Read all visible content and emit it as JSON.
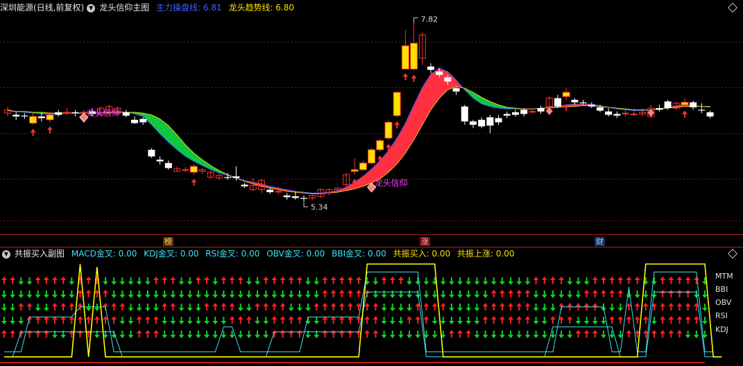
{
  "main_header": {
    "symbol": "深圳能源(日线,前复权)",
    "indicator_name": "龙头信仰主图",
    "line1_label": "主力操盘线: 6.81",
    "line2_label": "龙头趋势线: 6.80"
  },
  "sub_header": {
    "indicator_name": "共振买入副图",
    "items": [
      "MACD金叉: 0.00",
      "KDJ金叉: 0.00",
      "RSI金叉: 0.00",
      "OBV金叉: 0.00",
      "BBI金叉: 0.00",
      "共振买入: 0.00",
      "共振上涨: 0.00"
    ]
  },
  "markers": [
    "榜",
    "涨",
    "财"
  ],
  "signal_labels": [
    "MTM",
    "BBI",
    "OBV",
    "RSI",
    "KDJ"
  ],
  "colors": {
    "up_bar": "#ff3232",
    "down_bar": "#ffffff",
    "highlight_bar": "#ffe000",
    "band_up": "#ff3040",
    "band_down": "#10c840",
    "grid": "#8a1010",
    "sub_line_yellow": "#ffff00",
    "sub_line_cyan": "#40e0f0"
  },
  "chart_data": {
    "type": "candlestick",
    "annotations": [
      {
        "text": "7.82",
        "type": "max"
      },
      {
        "text": "5.34",
        "type": "min"
      },
      {
        "text": "龙头信仰",
        "type": "signal"
      },
      {
        "text": "龙头信仰",
        "type": "signal"
      }
    ],
    "candles": [
      {
        "o": 6.74,
        "c": 6.78,
        "h": 6.82,
        "l": 6.7
      },
      {
        "o": 6.72,
        "c": 6.7,
        "h": 6.76,
        "l": 6.66
      },
      {
        "o": 6.71,
        "c": 6.7,
        "h": 6.74,
        "l": 6.67
      },
      {
        "o": 6.62,
        "c": 6.7,
        "h": 6.74,
        "l": 6.6,
        "hl": 1
      },
      {
        "o": 6.7,
        "c": 6.68,
        "h": 6.74,
        "l": 6.64
      },
      {
        "o": 6.66,
        "c": 6.72,
        "h": 6.76,
        "l": 6.63,
        "hl": 1
      },
      {
        "o": 6.75,
        "c": 6.72,
        "h": 6.78,
        "l": 6.7
      },
      {
        "o": 6.74,
        "c": 6.75,
        "h": 6.8,
        "l": 6.71
      },
      {
        "o": 6.75,
        "c": 6.74,
        "h": 6.78,
        "l": 6.7
      },
      {
        "o": 6.74,
        "c": 6.75,
        "h": 6.78,
        "l": 6.72
      },
      {
        "o": 6.76,
        "c": 6.73,
        "h": 6.8,
        "l": 6.7
      },
      {
        "o": 6.72,
        "c": 6.8,
        "h": 6.82,
        "l": 6.7
      },
      {
        "o": 6.74,
        "c": 6.82,
        "h": 6.84,
        "l": 6.72
      },
      {
        "o": 6.74,
        "c": 6.8,
        "h": 6.82,
        "l": 6.72
      },
      {
        "o": 6.75,
        "c": 6.71,
        "h": 6.78,
        "l": 6.69
      },
      {
        "o": 6.66,
        "c": 6.62,
        "h": 6.7,
        "l": 6.61
      },
      {
        "o": 6.67,
        "c": 6.63,
        "h": 6.69,
        "l": 6.6
      },
      {
        "o": 6.3,
        "c": 6.22,
        "h": 6.32,
        "l": 6.2
      },
      {
        "o": 6.18,
        "c": 6.16,
        "h": 6.22,
        "l": 6.12
      },
      {
        "o": 6.14,
        "c": 6.08,
        "h": 6.17,
        "l": 6.06
      },
      {
        "o": 6.04,
        "c": 6.07,
        "h": 6.1,
        "l": 6.03
      },
      {
        "o": 6.06,
        "c": 6.06,
        "h": 6.09,
        "l": 6.03
      },
      {
        "o": 6.03,
        "c": 6.1,
        "h": 6.13,
        "l": 6.0,
        "hl": 1
      },
      {
        "o": 6.04,
        "c": 6.06,
        "h": 6.08,
        "l": 6.01
      },
      {
        "o": 5.97,
        "c": 6.03,
        "h": 6.05,
        "l": 5.95
      },
      {
        "o": 5.96,
        "c": 5.99,
        "h": 6.01,
        "l": 5.94
      },
      {
        "o": 5.97,
        "c": 5.96,
        "h": 6.02,
        "l": 5.94
      },
      {
        "o": 5.98,
        "c": 5.96,
        "h": 6.1,
        "l": 5.93
      },
      {
        "o": 5.88,
        "c": 5.86,
        "h": 5.9,
        "l": 5.84
      },
      {
        "o": 5.82,
        "c": 5.87,
        "h": 5.96,
        "l": 5.8
      },
      {
        "o": 5.82,
        "c": 5.93,
        "h": 5.95,
        "l": 5.78
      },
      {
        "o": 5.82,
        "c": 5.79,
        "h": 5.84,
        "l": 5.77
      },
      {
        "o": 5.8,
        "c": 5.8,
        "h": 5.85,
        "l": 5.76
      },
      {
        "o": 5.75,
        "c": 5.73,
        "h": 5.78,
        "l": 5.7
      },
      {
        "o": 5.74,
        "c": 5.72,
        "h": 5.8,
        "l": 5.7
      },
      {
        "o": 5.72,
        "c": 5.71,
        "h": 5.75,
        "l": 5.68
      },
      {
        "o": 5.72,
        "c": 5.75,
        "h": 5.76,
        "l": 5.69
      },
      {
        "o": 5.74,
        "c": 5.82,
        "h": 5.84,
        "l": 5.72
      },
      {
        "o": 5.78,
        "c": 5.82,
        "h": 5.84,
        "l": 5.75
      },
      {
        "o": 5.82,
        "c": 5.84,
        "h": 5.85,
        "l": 5.78
      },
      {
        "o": 5.88,
        "c": 6.0,
        "h": 6.02,
        "l": 5.85
      },
      {
        "o": 6.04,
        "c": 6.06,
        "h": 6.2,
        "l": 6.0,
        "hl": 1
      },
      {
        "o": 6.06,
        "c": 6.14,
        "h": 6.17,
        "l": 6.04,
        "hl": 1
      },
      {
        "o": 6.14,
        "c": 6.3,
        "h": 6.32,
        "l": 6.12,
        "hl": 1
      },
      {
        "o": 6.3,
        "c": 6.41,
        "h": 6.43,
        "l": 6.28,
        "hl": 1
      },
      {
        "o": 6.44,
        "c": 6.63,
        "h": 6.65,
        "l": 6.42,
        "hl": 1
      },
      {
        "o": 6.71,
        "c": 6.99,
        "h": 7.0,
        "l": 6.69,
        "hl": 1
      },
      {
        "o": 7.27,
        "c": 7.55,
        "h": 7.74,
        "l": 7.27,
        "hl": 1
      },
      {
        "o": 7.27,
        "c": 7.58,
        "h": 7.82,
        "l": 7.25,
        "hl": 1
      },
      {
        "o": 7.4,
        "c": 7.68,
        "h": 7.72,
        "l": 7.32
      },
      {
        "o": 7.3,
        "c": 7.26,
        "h": 7.34,
        "l": 7.22
      },
      {
        "o": 7.24,
        "c": 7.2,
        "h": 7.28,
        "l": 7.17
      },
      {
        "o": 7.17,
        "c": 7.12,
        "h": 7.2,
        "l": 7.08
      },
      {
        "o": 7.04,
        "c": 7.0,
        "h": 7.06,
        "l": 6.96
      },
      {
        "o": 6.82,
        "c": 6.64,
        "h": 6.84,
        "l": 6.6
      },
      {
        "o": 6.64,
        "c": 6.6,
        "h": 6.66,
        "l": 6.56
      },
      {
        "o": 6.66,
        "c": 6.58,
        "h": 6.69,
        "l": 6.56
      },
      {
        "o": 6.69,
        "c": 6.59,
        "h": 6.72,
        "l": 6.5
      },
      {
        "o": 6.68,
        "c": 6.63,
        "h": 6.72,
        "l": 6.6
      },
      {
        "o": 6.73,
        "c": 6.71,
        "h": 6.76,
        "l": 6.68
      },
      {
        "o": 6.75,
        "c": 6.72,
        "h": 6.78,
        "l": 6.7
      },
      {
        "o": 6.78,
        "c": 6.73,
        "h": 6.8,
        "l": 6.7
      },
      {
        "o": 6.76,
        "c": 6.76,
        "h": 6.8,
        "l": 6.74
      },
      {
        "o": 6.8,
        "c": 6.76,
        "h": 6.83,
        "l": 6.73
      },
      {
        "o": 6.82,
        "c": 6.92,
        "h": 6.94,
        "l": 6.72
      },
      {
        "o": 6.92,
        "c": 6.82,
        "h": 6.96,
        "l": 6.8
      },
      {
        "o": 6.94,
        "c": 6.99,
        "h": 7.04,
        "l": 6.9,
        "hl": 1
      },
      {
        "o": 6.9,
        "c": 6.87,
        "h": 6.92,
        "l": 6.84
      },
      {
        "o": 6.87,
        "c": 6.86,
        "h": 6.9,
        "l": 6.84
      },
      {
        "o": 6.84,
        "c": 6.82,
        "h": 6.87,
        "l": 6.8
      },
      {
        "o": 6.81,
        "c": 6.77,
        "h": 6.84,
        "l": 6.75
      },
      {
        "o": 6.76,
        "c": 6.72,
        "h": 6.8,
        "l": 6.7
      },
      {
        "o": 6.73,
        "c": 6.71,
        "h": 6.76,
        "l": 6.68
      },
      {
        "o": 6.73,
        "c": 6.74,
        "h": 6.78,
        "l": 6.7
      },
      {
        "o": 6.72,
        "c": 6.73,
        "h": 6.8,
        "l": 6.7
      },
      {
        "o": 6.73,
        "c": 6.75,
        "h": 6.8,
        "l": 6.7
      },
      {
        "o": 6.7,
        "c": 6.8,
        "h": 6.84,
        "l": 6.68
      },
      {
        "o": 6.8,
        "c": 6.78,
        "h": 6.84,
        "l": 6.76
      },
      {
        "o": 6.88,
        "c": 6.8,
        "h": 6.9,
        "l": 6.78
      },
      {
        "o": 6.8,
        "c": 6.86,
        "h": 6.88,
        "l": 6.78
      },
      {
        "o": 6.84,
        "c": 6.87,
        "h": 6.92,
        "l": 6.82,
        "hl": 1
      },
      {
        "o": 6.87,
        "c": 6.81,
        "h": 6.89,
        "l": 6.78
      },
      {
        "o": 6.78,
        "c": 6.77,
        "h": 6.86,
        "l": 6.74
      },
      {
        "o": 6.75,
        "c": 6.7,
        "h": 6.77,
        "l": 6.68
      }
    ],
    "series": [
      {
        "values": [
          6.78,
          6.76,
          6.75,
          6.74,
          6.73,
          6.73,
          6.73,
          6.74,
          6.74,
          6.74,
          6.74,
          6.75,
          6.75,
          6.76,
          6.75,
          6.73,
          6.7,
          6.6,
          6.49,
          6.39,
          6.3,
          6.22,
          6.16,
          6.11,
          6.06,
          6.02,
          5.99,
          5.96,
          5.93,
          5.91,
          5.89,
          5.86,
          5.84,
          5.82,
          5.8,
          5.79,
          5.78,
          5.78,
          5.79,
          5.81,
          5.85,
          5.91,
          5.98,
          6.07,
          6.17,
          6.29,
          6.44,
          6.62,
          6.84,
          7.05,
          7.21,
          7.28,
          7.24,
          7.14,
          7.02,
          6.92,
          6.85,
          6.82,
          6.8,
          6.79,
          6.79,
          6.79,
          6.79,
          6.8,
          6.81,
          6.82,
          6.84,
          6.85,
          6.85,
          6.85,
          6.83,
          6.81,
          6.79,
          6.78,
          6.77,
          6.77,
          6.78,
          6.79,
          6.81,
          6.83,
          6.84,
          6.83,
          6.82,
          6.81
        ]
      },
      {
        "values": [
          6.77,
          6.76,
          6.76,
          6.75,
          6.75,
          6.74,
          6.74,
          6.74,
          6.74,
          6.74,
          6.74,
          6.74,
          6.75,
          6.75,
          6.75,
          6.75,
          6.74,
          6.72,
          6.67,
          6.59,
          6.48,
          6.36,
          6.26,
          6.18,
          6.11,
          6.05,
          6.0,
          5.96,
          5.92,
          5.89,
          5.86,
          5.84,
          5.82,
          5.8,
          5.79,
          5.78,
          5.77,
          5.77,
          5.78,
          5.79,
          5.81,
          5.83,
          5.86,
          5.9,
          5.95,
          6.03,
          6.13,
          6.26,
          6.42,
          6.6,
          6.78,
          6.92,
          7.02,
          7.06,
          7.04,
          6.99,
          6.93,
          6.88,
          6.84,
          6.81,
          6.8,
          6.79,
          6.79,
          6.8,
          6.8,
          6.81,
          6.82,
          6.82,
          6.83,
          6.83,
          6.82,
          6.81,
          6.8,
          6.79,
          6.78,
          6.78,
          6.78,
          6.79,
          6.8,
          6.81,
          6.82,
          6.82,
          6.82,
          6.82
        ]
      }
    ],
    "ylim": [
      5.3,
      7.9
    ],
    "signals": {
      "rows": [
        "MTM",
        "BBI",
        "OBV",
        "RSI",
        "KDJ"
      ],
      "up_runs": [
        [
          [
            0,
            1
          ],
          [
            4,
            7
          ],
          [
            9,
            11
          ],
          [
            18,
            20
          ],
          [
            23,
            24
          ],
          [
            26,
            28
          ],
          [
            31,
            35
          ],
          [
            38,
            42
          ],
          [
            45,
            47
          ],
          [
            63,
            66
          ],
          [
            70,
            75
          ],
          [
            78,
            82
          ]
        ],
        [
          [
            9,
            12
          ],
          [
            38,
            43
          ],
          [
            58,
            62
          ],
          [
            69,
            73
          ],
          [
            78,
            81
          ]
        ],
        [
          [
            2,
            3
          ],
          [
            6,
            9
          ],
          [
            12,
            14
          ],
          [
            19,
            20
          ],
          [
            24,
            27
          ],
          [
            30,
            33
          ],
          [
            37,
            44
          ],
          [
            49,
            52
          ],
          [
            57,
            62
          ],
          [
            66,
            70
          ],
          [
            74,
            82
          ]
        ],
        [
          [
            3,
            13
          ],
          [
            16,
            18
          ],
          [
            27,
            29
          ],
          [
            32,
            35
          ],
          [
            38,
            44
          ],
          [
            48,
            50
          ],
          [
            57,
            62
          ],
          [
            65,
            67
          ],
          [
            72,
            76
          ],
          [
            78,
            82
          ]
        ],
        [
          [
            0,
            5
          ],
          [
            8,
            10
          ],
          [
            16,
            18
          ],
          [
            32,
            35
          ],
          [
            38,
            44
          ],
          [
            53,
            55
          ],
          [
            68,
            70
          ],
          [
            74,
            80
          ]
        ]
      ],
      "yellow": [
        0.05,
        0.05,
        0.05,
        0.05,
        0.05,
        0.05,
        0.05,
        0.05,
        0.05,
        0.98,
        0.05,
        0.95,
        0.05,
        0.05,
        0.05,
        0.05,
        0.05,
        0.05,
        0.05,
        0.05,
        0.05,
        0.05,
        0.05,
        0.05,
        0.05,
        0.05,
        0.05,
        0.05,
        0.05,
        0.05,
        0.05,
        0.05,
        0.05,
        0.05,
        0.05,
        0.05,
        0.05,
        0.05,
        0.05,
        0.05,
        0.05,
        0.05,
        0.05,
        0.98,
        0.98,
        0.98,
        0.98,
        0.98,
        0.98,
        0.98,
        0.98,
        0.98,
        0.05,
        0.05,
        0.05,
        0.05,
        0.05,
        0.05,
        0.05,
        0.05,
        0.05,
        0.05,
        0.05,
        0.05,
        0.05,
        0.05,
        0.05,
        0.05,
        0.05,
        0.05,
        0.05,
        0.05,
        0.05,
        0.05,
        0.05,
        0.05,
        0.98,
        0.98,
        0.98,
        0.98,
        0.98,
        0.98,
        0.98,
        0.98,
        0.05,
        0.05
      ],
      "cyan": [
        [
          0.1,
          0.1,
          0.1,
          0.45,
          0.45,
          0.45,
          0.45,
          0.45,
          0.45,
          0.55,
          0.55,
          0.55,
          0.55,
          0.1,
          0.1,
          0.1,
          0.1,
          0.1,
          0.1,
          0.1,
          0.1,
          0.1,
          0.1,
          0.1,
          0.1,
          0.1,
          0.35,
          0.35,
          0.1,
          0.1,
          0.1,
          0.1,
          0.1,
          0.1,
          0.1,
          0.1,
          0.45,
          0.45,
          0.45,
          0.45,
          0.45,
          0.45,
          0.45,
          0.9,
          0.9,
          0.9,
          0.9,
          0.9,
          0.9,
          0.9,
          0.1,
          0.1,
          0.1,
          0.1,
          0.1,
          0.1,
          0.1,
          0.1,
          0.1,
          0.1,
          0.1,
          0.1,
          0.1,
          0.1,
          0.1,
          0.1,
          0.55,
          0.55,
          0.55,
          0.55,
          0.55,
          0.55,
          0.1,
          0.1,
          0.75,
          0.1,
          0.1,
          0.9,
          0.9,
          0.9,
          0.9,
          0.9,
          0.9,
          0.1,
          0.1
        ],
        [
          0.05,
          0.05,
          0.3,
          0.3,
          0.3,
          0.3,
          0.3,
          0.3,
          0.3,
          0.3,
          0.3,
          0.3,
          0.3,
          0.3,
          0.05,
          0.05,
          0.05,
          0.05,
          0.05,
          0.05,
          0.05,
          0.05,
          0.05,
          0.05,
          0.05,
          0.05,
          0.05,
          0.05,
          0.05,
          0.05,
          0.05,
          0.05,
          0.3,
          0.3,
          0.3,
          0.3,
          0.3,
          0.3,
          0.3,
          0.3,
          0.3,
          0.3,
          0.3,
          0.7,
          0.7,
          0.7,
          0.7,
          0.7,
          0.7,
          0.7,
          0.05,
          0.05,
          0.05,
          0.05,
          0.05,
          0.05,
          0.05,
          0.05,
          0.05,
          0.05,
          0.05,
          0.05,
          0.05,
          0.05,
          0.05,
          0.35,
          0.35,
          0.35,
          0.35,
          0.35,
          0.35,
          0.35,
          0.35,
          0.05,
          0.05,
          0.05,
          0.05,
          0.7,
          0.7,
          0.7,
          0.7,
          0.7,
          0.7,
          0.05,
          0.05
        ]
      ]
    }
  }
}
